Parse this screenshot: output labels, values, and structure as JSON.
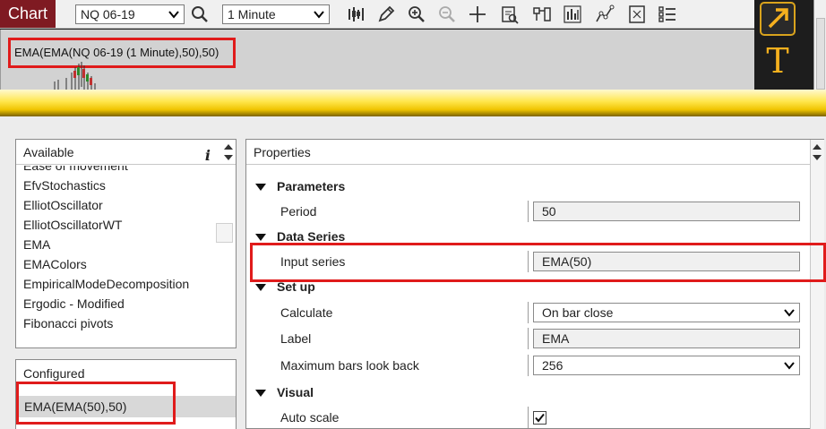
{
  "toolbar": {
    "chart_tab": "Chart",
    "instrument": "NQ 06-19",
    "interval": "1 Minute",
    "icons": [
      "bar-type-icon",
      "pencil-icon",
      "zoom-in-icon",
      "zoom-out-icon",
      "crosshair-icon",
      "data-box-icon",
      "templates-icon",
      "strategies-icon",
      "drawing-tools-icon",
      "properties-icon",
      "indicators-list-icon"
    ]
  },
  "chart": {
    "indicator_label": "EMA(EMA(NQ 06-19 (1 Minute),50),50)"
  },
  "side_panel": {
    "text_tool": "T"
  },
  "available": {
    "header": "Available",
    "info": "i",
    "items": [
      "Ease of movement",
      "EfvStochastics",
      "ElliotOscillator",
      "ElliotOscillatorWT",
      "EMA",
      "EMAColors",
      "EmpiricalModeDecomposition",
      "Ergodic - Modified",
      "Fibonacci pivots"
    ]
  },
  "configured": {
    "header": "Configured",
    "item": "EMA(EMA(50),50)"
  },
  "properties": {
    "header": "Properties",
    "categories": {
      "parameters": "Parameters",
      "data_series": "Data Series",
      "setup": "Set up",
      "visual": "Visual"
    },
    "rows": {
      "period": {
        "label": "Period",
        "value": "50"
      },
      "input_series": {
        "label": "Input series",
        "value": "EMA(50)"
      },
      "calculate": {
        "label": "Calculate",
        "value": "On bar close"
      },
      "label": {
        "label": "Label",
        "value": "EMA"
      },
      "max_bars": {
        "label": "Maximum bars look back",
        "value": "256"
      },
      "auto_scale": {
        "label": "Auto scale",
        "checked": true
      }
    }
  },
  "colors": {
    "chart_tab": "#7f1a22",
    "highlight": "#e01b1b",
    "accent": "#f5b01e"
  }
}
